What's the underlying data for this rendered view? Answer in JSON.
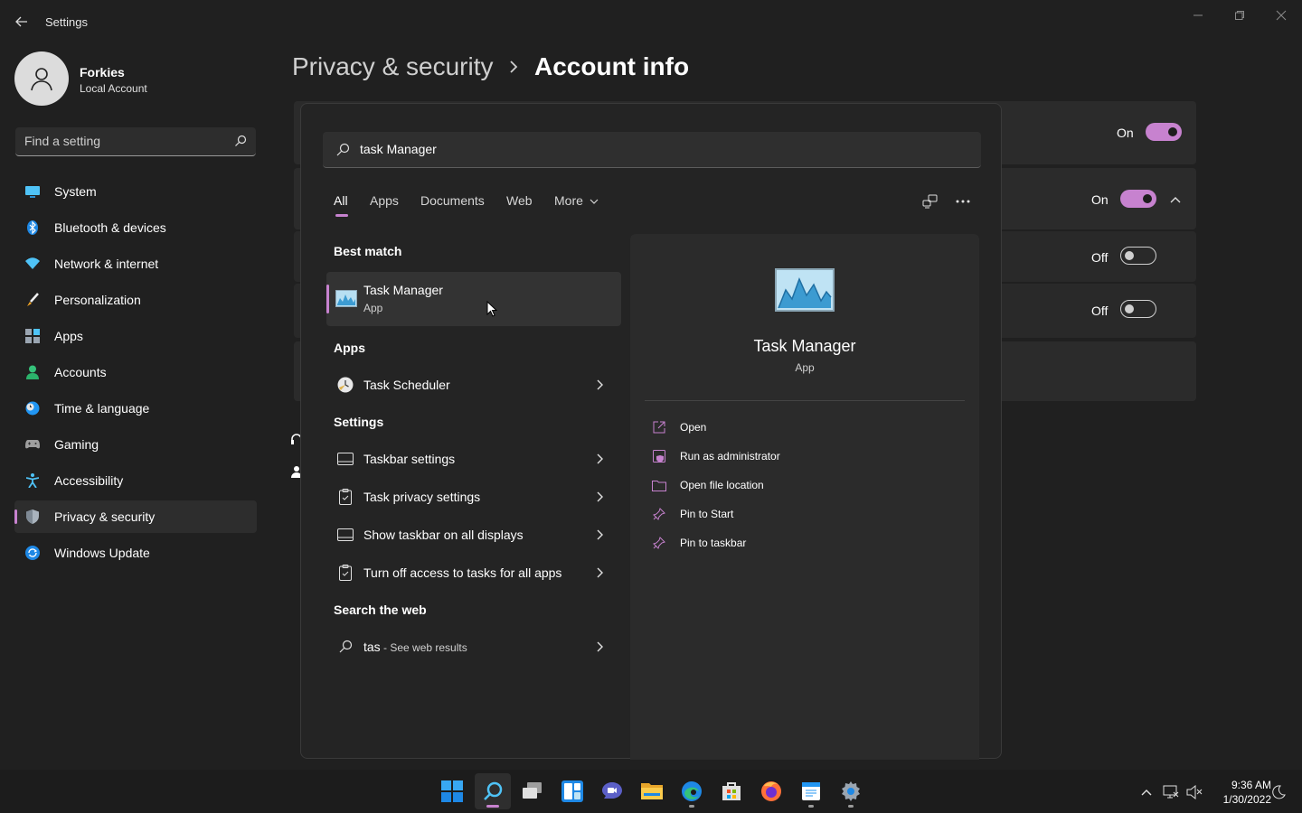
{
  "window": {
    "title": "Settings"
  },
  "user": {
    "name": "Forkies",
    "account_type": "Local Account"
  },
  "search": {
    "placeholder": "Find a setting"
  },
  "nav": {
    "items": [
      {
        "label": "System",
        "icon": "monitor-icon"
      },
      {
        "label": "Bluetooth & devices",
        "icon": "bluetooth-icon"
      },
      {
        "label": "Network & internet",
        "icon": "wifi-icon"
      },
      {
        "label": "Personalization",
        "icon": "brush-icon"
      },
      {
        "label": "Apps",
        "icon": "apps-icon"
      },
      {
        "label": "Accounts",
        "icon": "person-icon"
      },
      {
        "label": "Time & language",
        "icon": "globe-clock-icon"
      },
      {
        "label": "Gaming",
        "icon": "controller-icon"
      },
      {
        "label": "Accessibility",
        "icon": "accessibility-icon"
      },
      {
        "label": "Privacy & security",
        "icon": "shield-icon",
        "active": true
      },
      {
        "label": "Windows Update",
        "icon": "update-icon"
      }
    ]
  },
  "breadcrumb": {
    "parent": "Privacy & security",
    "separator": "›",
    "current": "Account info"
  },
  "background_settings": [
    {
      "state": "On",
      "toggle": true
    },
    {
      "state": "On",
      "toggle": true,
      "expanded": true
    },
    {
      "state": "Off",
      "toggle": false
    },
    {
      "state": "Off",
      "toggle": false
    }
  ],
  "start_search": {
    "query": "task Manager",
    "tabs": [
      "All",
      "Apps",
      "Documents",
      "Web",
      "More"
    ],
    "active_tab": "All",
    "best_match": {
      "heading": "Best match",
      "name": "Task Manager",
      "type": "App"
    },
    "apps": {
      "heading": "Apps",
      "items": [
        "Task Scheduler"
      ]
    },
    "settings": {
      "heading": "Settings",
      "items": [
        "Taskbar settings",
        "Task privacy settings",
        "Show taskbar on all displays",
        "Turn off access to tasks for all apps"
      ]
    },
    "web": {
      "heading": "Search the web",
      "query": "tas",
      "suffix": " - See web results"
    },
    "preview": {
      "name": "Task Manager",
      "type": "App",
      "actions": [
        "Open",
        "Run as administrator",
        "Open file location",
        "Pin to Start",
        "Pin to taskbar"
      ]
    }
  },
  "taskbar": {
    "apps": [
      "start-icon",
      "search-icon",
      "task-view-icon",
      "widgets-icon",
      "chat-icon",
      "file-explorer-icon",
      "edge-icon",
      "store-icon",
      "firefox-icon",
      "notepad-icon",
      "settings-icon"
    ],
    "clock": {
      "time": "9:36 AM",
      "date": "1/30/2022"
    }
  },
  "colors": {
    "accent": "#c782cf",
    "background": "#202020",
    "surface": "#2b2b2b"
  }
}
